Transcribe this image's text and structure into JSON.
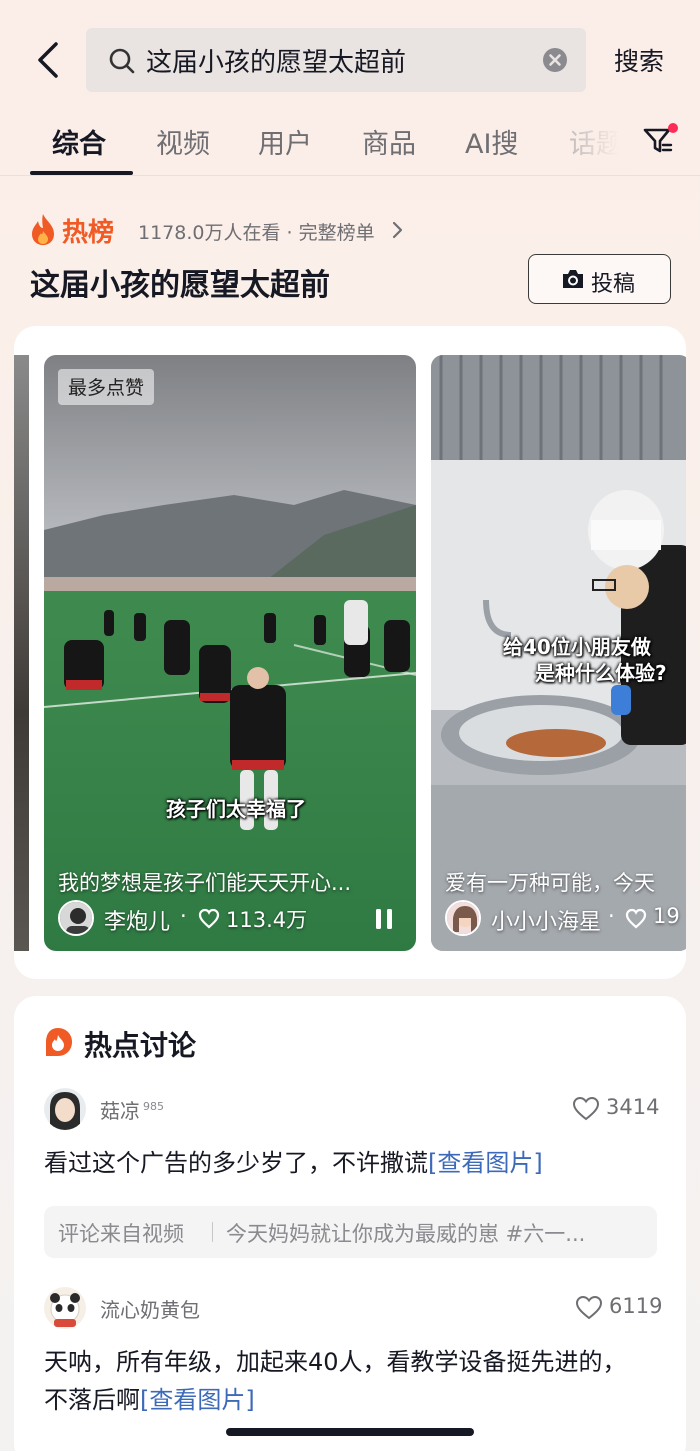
{
  "search": {
    "query": "这届小孩的愿望太超前",
    "submit_label": "搜索"
  },
  "tabs": [
    {
      "label": "综合",
      "active": true
    },
    {
      "label": "视频"
    },
    {
      "label": "用户"
    },
    {
      "label": "商品"
    },
    {
      "label": "AI搜"
    },
    {
      "label": "话题"
    }
  ],
  "hot": {
    "label": "热榜",
    "meta": "1178.0万人在看 · 完整榜单",
    "topic_title": "这届小孩的愿望太超前",
    "post_label": "投稿"
  },
  "videos": [
    {
      "badge": "最多点赞",
      "overlay_caption": "孩子们太幸福了",
      "caption": "我的梦想是孩子们能天天开心...",
      "author": "李炮儿",
      "likes": "113.4万"
    },
    {
      "overlay_caption_line1": "给40位小朋友做",
      "overlay_caption_line2": "是种什么体验?",
      "caption": "爱有一万种可能，今天",
      "author": "小小小海星",
      "likes": "19"
    }
  ],
  "discussion": {
    "title": "热点讨论",
    "comments": [
      {
        "user": "菇凉",
        "user_tag": "985",
        "likes": "3414",
        "text": "看过这个广告的多少岁了，不许撒谎",
        "link": "[查看图片]",
        "source_label": "评论来自视频",
        "source_text": "今天妈妈就让你成为最威的崽 #六一..."
      },
      {
        "user": "流心奶黄包",
        "likes": "6119",
        "text": "天呐，所有年级，加起来40人，看教学设备挺先进的，不落后啊",
        "link": "[查看图片]"
      }
    ]
  },
  "colors": {
    "hot_orange": "#f05a24",
    "link_blue": "#3d6ab8",
    "filter_dot": "#fe2c55"
  }
}
